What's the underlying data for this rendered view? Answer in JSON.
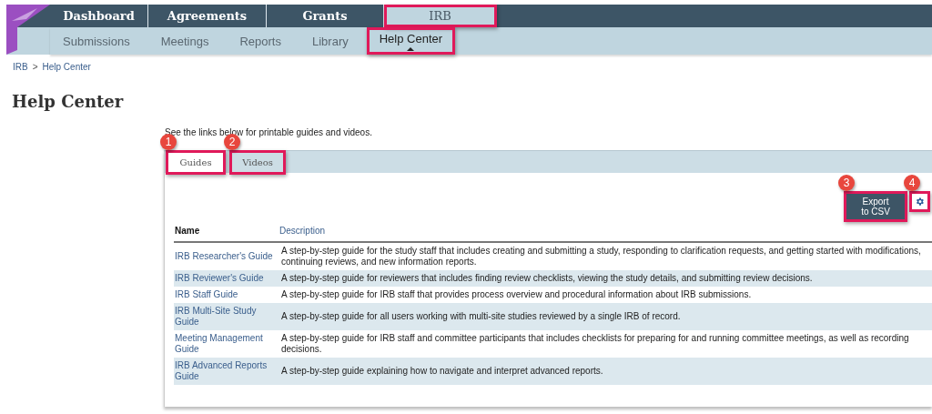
{
  "nav": {
    "tabs": [
      {
        "label": "Dashboard",
        "selected": false,
        "highlighted": false
      },
      {
        "label": "Agreements",
        "selected": false,
        "highlighted": false
      },
      {
        "label": "Grants",
        "selected": false,
        "highlighted": false
      },
      {
        "label": "IRB",
        "selected": true,
        "highlighted": true
      }
    ],
    "subtabs": [
      {
        "label": "Submissions",
        "selected": false,
        "highlighted": false
      },
      {
        "label": "Meetings",
        "selected": false,
        "highlighted": false
      },
      {
        "label": "Reports",
        "selected": false,
        "highlighted": false
      },
      {
        "label": "Library",
        "selected": false,
        "highlighted": false
      },
      {
        "label": "Help Center",
        "selected": true,
        "highlighted": true
      }
    ]
  },
  "breadcrumb": [
    "IRB",
    "Help Center"
  ],
  "breadcrumb_separator": ">",
  "title": "Help Center",
  "intro": "See the links below for printable guides and videos.",
  "tabs": [
    {
      "label": "Guides",
      "selected": true,
      "highlighted": true,
      "callout": "1"
    },
    {
      "label": "Videos",
      "selected": false,
      "highlighted": true,
      "callout": "2"
    }
  ],
  "export_button": {
    "label": "Export\nto CSV",
    "highlighted": true,
    "callout": "3"
  },
  "settings_button": {
    "highlighted": true,
    "callout": "4"
  },
  "table": {
    "columns": [
      "Name",
      "Description"
    ],
    "rows": [
      {
        "name": "IRB Researcher's Guide",
        "description": "A step-by-step guide for the study staff that includes creating and submitting a study, responding to clarification requests, and getting started with modifications, continuing reviews, and new information reports."
      },
      {
        "name": "IRB Reviewer's Guide",
        "description": "A step-by-step guide for reviewers that includes finding review checklists, viewing the study details, and submitting review decisions."
      },
      {
        "name": "IRB Staff Guide",
        "description": "A step-by-step guide for IRB staff that provides process overview and procedural information about IRB submissions."
      },
      {
        "name": "IRB Multi-Site Study Guide",
        "description": "A step-by-step guide for all users working with multi-site studies reviewed by a single IRB of record."
      },
      {
        "name": "Meeting Management Guide",
        "description": "A step-by-step guide for IRB staff and committee participants that includes checklists for preparing for and running committee meetings, as well as recording decisions."
      },
      {
        "name": "IRB Advanced Reports Guide",
        "description": "A step-by-step guide explaining how to navigate and interpret advanced reports."
      }
    ]
  }
}
